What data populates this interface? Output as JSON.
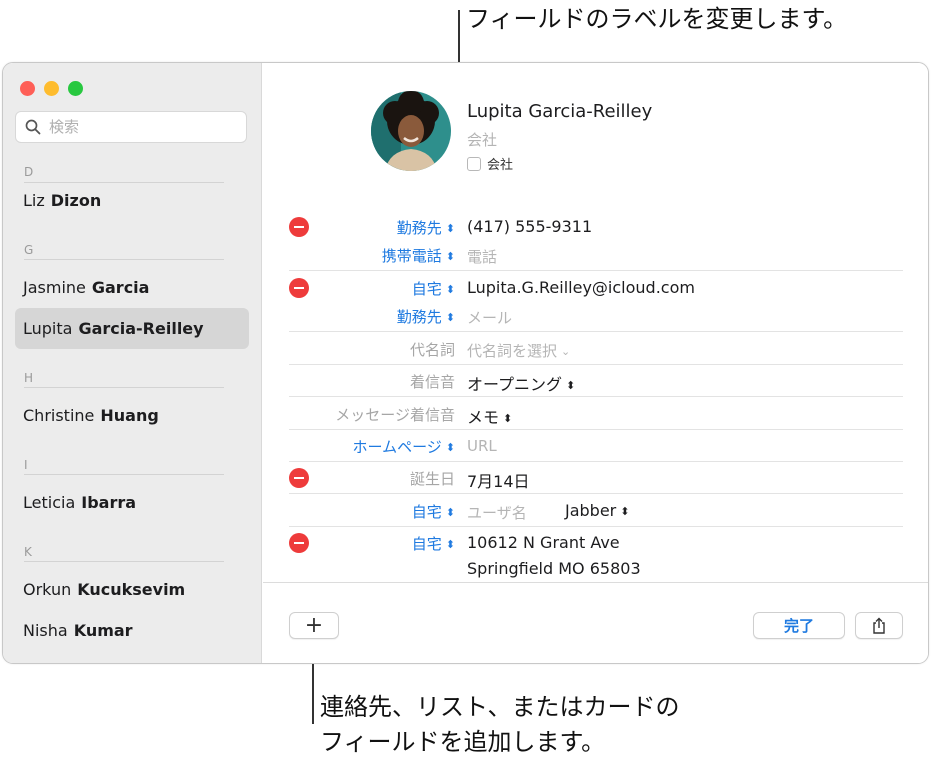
{
  "annotations": {
    "top": "フィールドのラベルを変更します。",
    "bottom_line1": "連絡先、リスト、またはカードの",
    "bottom_line2": "フィールドを追加します。"
  },
  "sidebar": {
    "search_placeholder": "検索",
    "groups": [
      {
        "letter": "D",
        "contacts": [
          {
            "first": "Liz",
            "last": "Dizon"
          }
        ]
      },
      {
        "letter": "G",
        "contacts": [
          {
            "first": "Jasmine",
            "last": "Garcia"
          },
          {
            "first": "Lupita",
            "last": "Garcia-Reilley",
            "selected": true
          }
        ]
      },
      {
        "letter": "H",
        "contacts": [
          {
            "first": "Christine",
            "last": "Huang"
          }
        ]
      },
      {
        "letter": "I",
        "contacts": [
          {
            "first": "Leticia",
            "last": "Ibarra"
          }
        ]
      },
      {
        "letter": "K",
        "contacts": [
          {
            "first": "Orkun",
            "last": "Kucuksevim"
          },
          {
            "first": "Nisha",
            "last": "Kumar"
          }
        ]
      }
    ]
  },
  "card": {
    "name": "Lupita  Garcia-Reilley",
    "company_placeholder": "会社",
    "company_checkbox_label": "会社",
    "fields": {
      "phone_work_label": "勤務先",
      "phone_work_value": "(417) 555-9311",
      "phone_mobile_label": "携帯電話",
      "phone_placeholder": "電話",
      "email_home_label": "自宅",
      "email_home_value": "Lupita.G.Reilley@icloud.com",
      "email_work_label": "勤務先",
      "email_placeholder": "メール",
      "pronoun_label": "代名詞",
      "pronoun_value": "代名詞を選択",
      "ringtone_label": "着信音",
      "ringtone_value": "オープニング",
      "text_tone_label": "メッセージ着信音",
      "text_tone_value": "メモ",
      "homepage_label": "ホームページ",
      "homepage_placeholder": "URL",
      "birthday_label": "誕生日",
      "birthday_value": "7月14日",
      "im_label": "自宅",
      "im_username_placeholder": "ユーザ名",
      "im_service": "Jabber",
      "address_label": "自宅",
      "address_line1": "10612 N Grant Ave",
      "address_line2": "Springfield MO 65803"
    }
  },
  "footer": {
    "add_label": "+",
    "done_label": "完了"
  },
  "colors": {
    "accent": "#1f7ae0",
    "remove": "#ee3b3b",
    "selection": "#d6d6d6"
  },
  "icons": [
    "search-icon",
    "remove-field-icon",
    "stepper-chevron-icon",
    "share-icon"
  ]
}
